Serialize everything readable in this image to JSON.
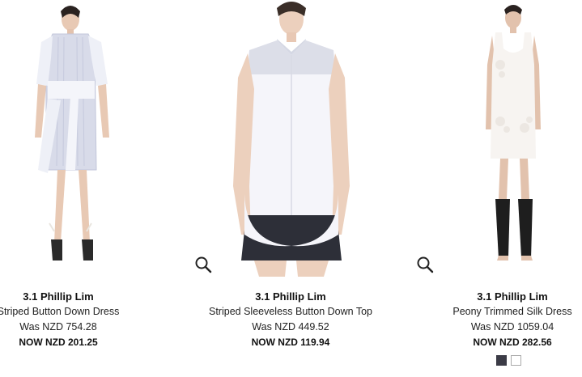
{
  "products": [
    {
      "brand": "3.1 Phillip Lim",
      "name": "Striped Button Down Dress",
      "was_price": "Was NZD 754.28",
      "now_price": "NOW NZD 201.25",
      "icon": "none"
    },
    {
      "brand": "3.1 Phillip Lim",
      "name": "Striped Sleeveless Button Down Top",
      "was_price": "Was NZD 449.52",
      "now_price": "NOW NZD 119.94",
      "icon": "magnifier-icon"
    },
    {
      "brand": "3.1 Phillip Lim",
      "name": "Peony Trimmed Silk Dress",
      "was_price": "Was NZD 1059.04",
      "now_price": "NOW NZD 282.56",
      "icon": "magnifier-icon",
      "swatches": [
        {
          "color": "#3b3b46"
        },
        {
          "color": "#ffffff"
        }
      ]
    }
  ]
}
